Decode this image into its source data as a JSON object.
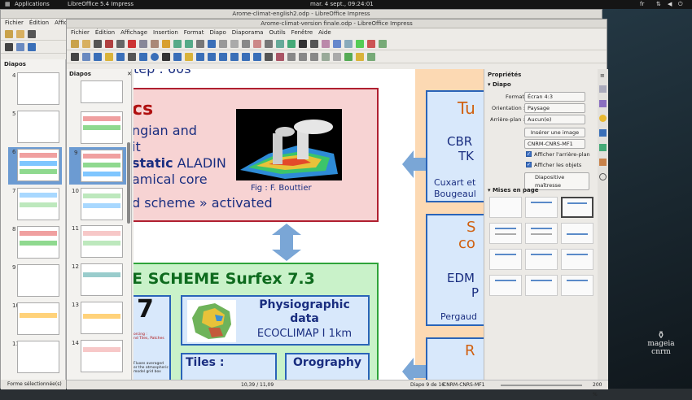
{
  "topbar": {
    "applications": "Applications",
    "active_app": "LibreOffice 5.4 Impress",
    "datetime": "mar. 4 sept., 09:24:01",
    "lang": "fr"
  },
  "back_window": {
    "title": "Arome-climat-english2.odp - LibreOffice Impress",
    "menu": [
      "Fichier",
      "Édition",
      "Affichag"
    ],
    "panel_title": "Diapos",
    "slide_numbers": [
      "4",
      "5",
      "6",
      "7",
      "8",
      "9",
      "10",
      "11"
    ],
    "status": "Forme sélectionnée(s)"
  },
  "front_window": {
    "title": "Arome-climat-version finale.odp - LibreOffice Impress",
    "menu": [
      "Fichier",
      "Édition",
      "Affichage",
      "Insertion",
      "Format",
      "Diapo",
      "Diaporama",
      "Outils",
      "Fenêtre",
      "Aide"
    ],
    "panel_title": "Diapos",
    "slide_numbers": [
      "9",
      "10",
      "11",
      "12",
      "13",
      "14"
    ],
    "slide": {
      "top_title": "tep : 60s",
      "red_head": "cs",
      "red_lines": [
        "ngian and",
        "it"
      ],
      "red_bold": "static",
      "red_rest": " ALADIN",
      "red_line4": "amical core",
      "red_line5": "d scheme » activated",
      "fig_caption": "Fig : F. Bouttier",
      "green_title": "E SCHEME Surfex 7.3",
      "physio_title": "Physiographic data",
      "physio_sub": "ECOCLIMAP I 1km",
      "tiles": "Tiles :",
      "orography": "Orography",
      "small_notes": [
        "orcing :",
        "nd Tiles, Patches",
        "Fluxes averaged",
        "er the atmospheric",
        "model grid box"
      ],
      "right_frags": [
        "Tu",
        "CBR",
        "TK",
        "Cuxart et",
        "Bougeaul",
        "S",
        "co",
        "EDM",
        "P",
        "Pergaud",
        "R"
      ]
    },
    "status": {
      "coords": "10,39 / 11,09",
      "slide_info": "Diapo 9 de 16",
      "master": "CNRM-CNRS-MF1",
      "zoom": "200 %"
    }
  },
  "sidebar": {
    "title": "Propriétés",
    "section_diapo": "Diapo",
    "format_label": "Format :",
    "format_value": "Écran 4:3",
    "orientation_label": "Orientation :",
    "orientation_value": "Paysage",
    "background_label": "Arrière-plan :",
    "background_value": "Aucun(e)",
    "insert_image": "Insérer une image",
    "master_value": "CNRM-CNRS-MF1",
    "show_bg": "Afficher l'arrière-plan",
    "show_objects": "Afficher les objets",
    "master_button": "Diapositive maîtresse",
    "section_layouts": "Mises en page"
  },
  "logo": {
    "text1": "mageia",
    "text2": "cnrm"
  },
  "colors": {
    "accent": "#6c9bd2",
    "red_box_fill": "#f7d3d3",
    "red_box_border": "#b02030",
    "green_box_fill": "#c9f2c9",
    "green_box_border": "#2ea43a",
    "blue_box_fill": "#d8e8fb",
    "blue_box_border": "#2a64b8",
    "orange_bg": "#fcd9b3",
    "arrow": "#7aa6d6"
  }
}
